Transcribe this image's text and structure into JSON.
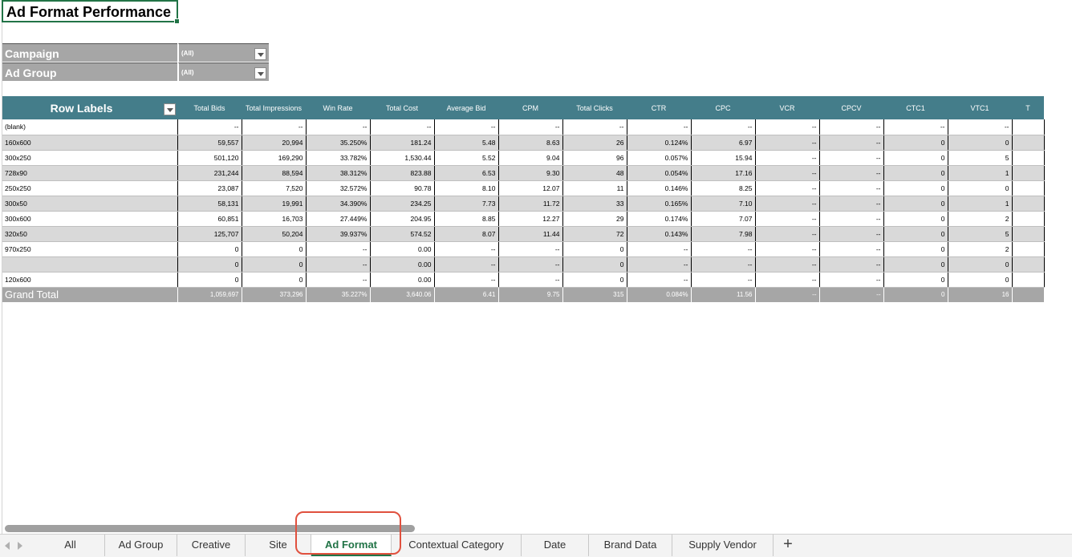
{
  "title": "Ad Format Performance",
  "filters": [
    {
      "label": "Campaign",
      "value": "(All)"
    },
    {
      "label": "Ad Group",
      "value": "(All)"
    }
  ],
  "pivot": {
    "row_label_header": "Row Labels",
    "columns": [
      "Total Bids",
      "Total Impressions",
      "Win Rate",
      "Total Cost",
      "Average Bid",
      "CPM",
      "Total Clicks",
      "CTR",
      "CPC",
      "VCR",
      "CPCV",
      "CTC1",
      "VTC1",
      "T"
    ],
    "rows": [
      {
        "label": "(blank)",
        "values": [
          "--",
          "--",
          "--",
          "--",
          "--",
          "--",
          "--",
          "--",
          "--",
          "--",
          "--",
          "--",
          "--"
        ]
      },
      {
        "label": "160x600",
        "values": [
          "59,557",
          "20,994",
          "35.250%",
          "181.24",
          "5.48",
          "8.63",
          "26",
          "0.124%",
          "6.97",
          "--",
          "--",
          "0",
          "0"
        ]
      },
      {
        "label": "300x250",
        "values": [
          "501,120",
          "169,290",
          "33.782%",
          "1,530.44",
          "5.52",
          "9.04",
          "96",
          "0.057%",
          "15.94",
          "--",
          "--",
          "0",
          "5"
        ]
      },
      {
        "label": "728x90",
        "values": [
          "231,244",
          "88,594",
          "38.312%",
          "823.88",
          "6.53",
          "9.30",
          "48",
          "0.054%",
          "17.16",
          "--",
          "--",
          "0",
          "1"
        ]
      },
      {
        "label": "250x250",
        "values": [
          "23,087",
          "7,520",
          "32.572%",
          "90.78",
          "8.10",
          "12.07",
          "11",
          "0.146%",
          "8.25",
          "--",
          "--",
          "0",
          "0"
        ]
      },
      {
        "label": "300x50",
        "values": [
          "58,131",
          "19,991",
          "34.390%",
          "234.25",
          "7.73",
          "11.72",
          "33",
          "0.165%",
          "7.10",
          "--",
          "--",
          "0",
          "1"
        ]
      },
      {
        "label": "300x600",
        "values": [
          "60,851",
          "16,703",
          "27.449%",
          "204.95",
          "8.85",
          "12.27",
          "29",
          "0.174%",
          "7.07",
          "--",
          "--",
          "0",
          "2"
        ]
      },
      {
        "label": "320x50",
        "values": [
          "125,707",
          "50,204",
          "39.937%",
          "574.52",
          "8.07",
          "11.44",
          "72",
          "0.143%",
          "7.98",
          "--",
          "--",
          "0",
          "5"
        ]
      },
      {
        "label": "970x250",
        "values": [
          "0",
          "0",
          "--",
          "0.00",
          "--",
          "--",
          "0",
          "--",
          "--",
          "--",
          "--",
          "0",
          "2"
        ]
      },
      {
        "label": "",
        "values": [
          "0",
          "0",
          "--",
          "0.00",
          "--",
          "--",
          "0",
          "--",
          "--",
          "--",
          "--",
          "0",
          "0"
        ]
      },
      {
        "label": "120x600",
        "values": [
          "0",
          "0",
          "--",
          "0.00",
          "--",
          "--",
          "0",
          "--",
          "--",
          "--",
          "--",
          "0",
          "0"
        ]
      }
    ],
    "grand_total": {
      "label": "Grand Total",
      "values": [
        "1,059,697",
        "373,296",
        "35.227%",
        "3,640.06",
        "6.41",
        "9.75",
        "315",
        "0.084%",
        "11.56",
        "--",
        "--",
        "0",
        "16"
      ]
    }
  },
  "tabs": [
    {
      "label": "All",
      "active": false
    },
    {
      "label": "Ad Group",
      "active": false
    },
    {
      "label": "Creative",
      "active": false
    },
    {
      "label": "Site",
      "active": false
    },
    {
      "label": "Ad Format",
      "active": true
    },
    {
      "label": "Contextual Category",
      "active": false
    },
    {
      "label": "Date",
      "active": false
    },
    {
      "label": "Brand Data",
      "active": false
    },
    {
      "label": "Supply Vendor",
      "active": false
    }
  ],
  "add_tab_symbol": "+",
  "colors": {
    "header_teal": "#447d8a",
    "filter_gray": "#a6a6a6",
    "band_gray": "#d9d9d9",
    "excel_green": "#217346",
    "highlight_red": "#e0503e"
  }
}
